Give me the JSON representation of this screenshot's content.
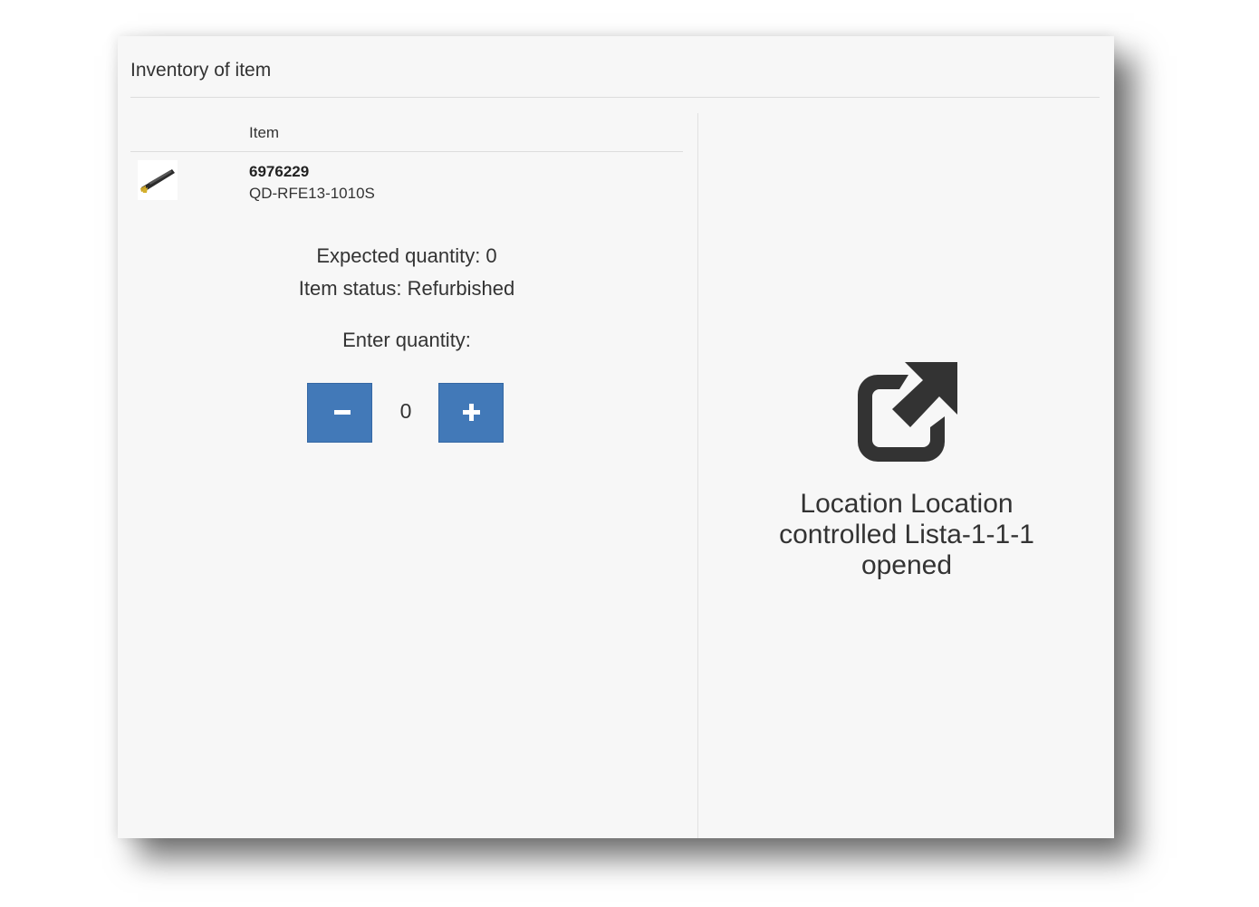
{
  "dialog": {
    "title": "Inventory of item"
  },
  "table": {
    "column_image": "",
    "column_item": "Item",
    "row": {
      "image_icon": "drill-tool-thumbnail",
      "item_number": "6976229",
      "item_code": "QD-RFE13-1010S"
    }
  },
  "details": {
    "expected_quantity": "Expected quantity: 0",
    "item_status": "Item status: Refurbished",
    "enter_quantity_label": "Enter quantity:"
  },
  "quantity": {
    "value": "0",
    "minus_icon": "minus-icon",
    "plus_icon": "plus-icon"
  },
  "location": {
    "icon": "external-link-icon",
    "message": "Location Location controlled Lista-1-1-1 opened"
  },
  "colors": {
    "button_blue": "#4279b8",
    "panel_bg": "#f7f7f7",
    "text": "#333333"
  }
}
